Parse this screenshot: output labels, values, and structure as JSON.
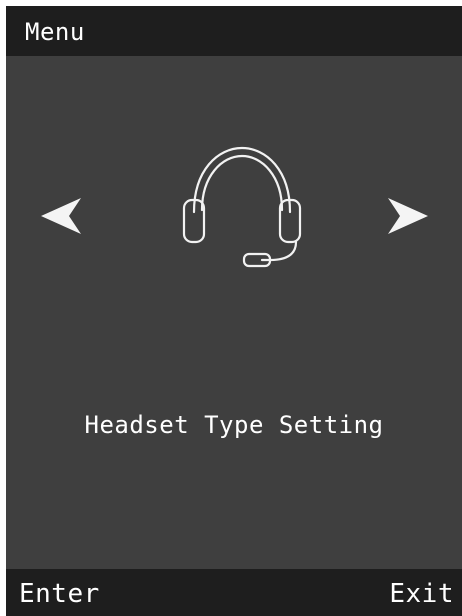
{
  "header": {
    "title": "Menu"
  },
  "menu": {
    "current_item": {
      "icon": "headset-icon",
      "label": "Headset Type Setting"
    },
    "prev_icon": "left-arrow-icon",
    "next_icon": "right-arrow-icon"
  },
  "softkeys": {
    "left_label": "Enter",
    "right_label": "Exit"
  },
  "colors": {
    "bar_background": "#1e1e1e",
    "main_background": "#3f3f3f",
    "foreground": "#ffffff"
  }
}
